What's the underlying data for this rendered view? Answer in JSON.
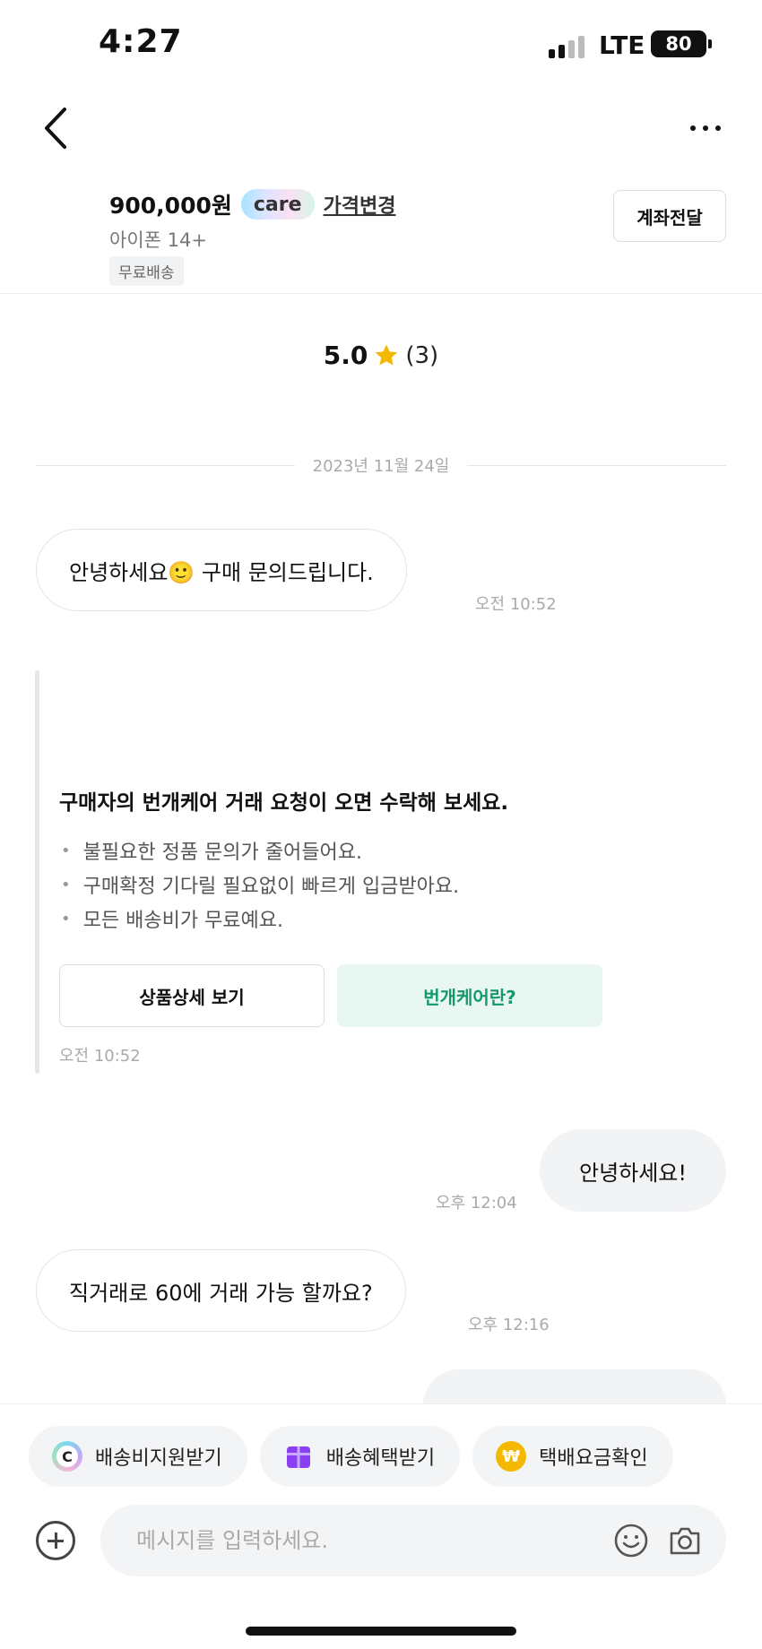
{
  "status_bar": {
    "time": "4:27",
    "network": "LTE",
    "battery": "80"
  },
  "product": {
    "price": "900,000원",
    "care_badge": "care",
    "price_change": "가격변경",
    "name": "아이폰 14+",
    "shipping_badge": "무료배송",
    "account_transfer": "계좌전달"
  },
  "rating": {
    "score": "5.0",
    "count": "(3)"
  },
  "date_divider": "2023년 11월 24일",
  "messages": [
    {
      "text": "안녕하세요🙂 구매 문의드립니다.",
      "time": "오전 10:52"
    },
    {
      "text": "안녕하세요!",
      "time": "오후 12:04"
    },
    {
      "text": "직거래로 60에 거래 가능 할까요?",
      "time": "오후 12:16"
    }
  ],
  "notice": {
    "title": "구매자의 번개케어 거래 요청이 오면 수락해 보세요.",
    "items": [
      "불필요한 정품 문의가 줄어들어요.",
      "구매확정 기다릴 필요없이 빠르게 입금받아요.",
      "모든 배송비가 무료예요."
    ],
    "detail_button": "상품상세 보기",
    "care_button": "번개케어란?",
    "time": "오전 10:52"
  },
  "quick_actions": [
    {
      "label": "배송비지원받기",
      "icon": "care-c-icon"
    },
    {
      "label": "배송혜택받기",
      "icon": "gift-icon"
    },
    {
      "label": "택배요금확인",
      "icon": "won-coin-icon"
    }
  ],
  "composer": {
    "placeholder": "메시지를 입력하세요."
  },
  "colors": {
    "accent_green": "#149a6a",
    "gift_purple": "#8a3ff2",
    "coin_yellow": "#f5b800"
  }
}
